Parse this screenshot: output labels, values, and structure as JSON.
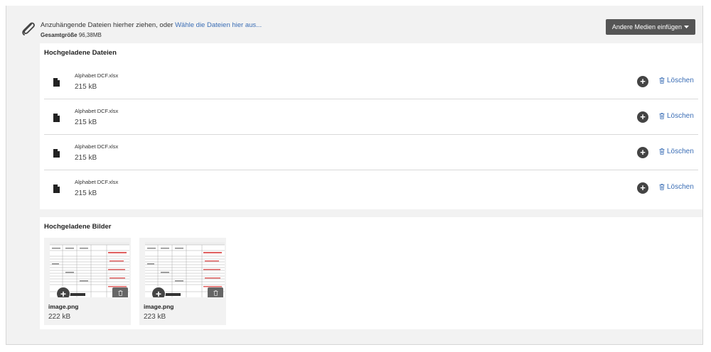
{
  "dropzone": {
    "prompt": "Anzuhängende Dateien hierher ziehen, oder ",
    "choose_link": "Wähle die Dateien hier aus...",
    "total_label": "Gesamtgröße",
    "total_value": "96,38MB",
    "media_button": "Andere Medien einfügen"
  },
  "uploaded_files": {
    "title": "Hochgeladene Dateien",
    "delete_label": "Löschen",
    "items": [
      {
        "name": "Alphabet DCF.xlsx",
        "size": "215 kB"
      },
      {
        "name": "Alphabet DCF.xlsx",
        "size": "215 kB"
      },
      {
        "name": "Alphabet DCF.xlsx",
        "size": "215 kB"
      },
      {
        "name": "Alphabet DCF.xlsx",
        "size": "215 kB"
      }
    ]
  },
  "uploaded_images": {
    "title": "Hochgeladene Bilder",
    "items": [
      {
        "name": "image.png",
        "size": "222 kB"
      },
      {
        "name": "image.png",
        "size": "223 kB"
      }
    ]
  },
  "colors": {
    "link": "#3a6db5",
    "button_dark": "#555555",
    "panel_bg": "#f2f2f2"
  },
  "icons": [
    "paperclip-icon",
    "caret-down-icon",
    "document-icon",
    "plus-circle-icon",
    "trash-icon"
  ]
}
